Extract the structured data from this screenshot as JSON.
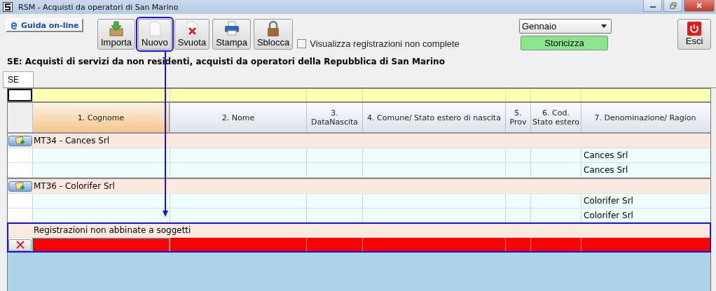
{
  "window": {
    "title": "RSM - Acquisti da operatori di San Marino"
  },
  "help_button": {
    "label": "Guida on-line"
  },
  "toolbar": [
    {
      "label": "Importa",
      "highlighted": false
    },
    {
      "label": "Nuovo",
      "highlighted": true
    },
    {
      "label": "Svuota",
      "highlighted": false
    },
    {
      "label": "Stampa",
      "highlighted": false
    },
    {
      "label": "Sblocca",
      "highlighted": false
    }
  ],
  "incomplete_checkbox": {
    "label": "Visualizza registrazioni non complete",
    "checked": false
  },
  "month_select": {
    "value": "Gennaio"
  },
  "archive_button": {
    "label": "Storicizza"
  },
  "exit_button": {
    "label": "Esci"
  },
  "heading": "SE: Acquisti di servizi da non residenti, acquisti da operatori della Repubblica di San Marino",
  "tabs": [
    {
      "label": "SE",
      "selected": true
    }
  ],
  "table": {
    "columns": [
      {
        "label": "1. Cognome",
        "selected": true
      },
      {
        "label": "2. Nome",
        "selected": false
      },
      {
        "label": "3. DataNascita",
        "selected": false
      },
      {
        "label": "4. Comune/ Stato estero di nascita",
        "selected": false
      },
      {
        "label": "5. Prov",
        "selected": false
      },
      {
        "label": "6. Cod. Stato estero",
        "selected": false
      },
      {
        "label": "7. Denominazione/ Ragion",
        "selected": false
      }
    ],
    "groups": [
      {
        "title": "MT34 - Cances Srl",
        "rows": [
          {
            "denominazione": "Cances Srl"
          },
          {
            "denominazione": "Cances Srl"
          }
        ]
      },
      {
        "title": "MT36 - Colorifer Srl",
        "rows": [
          {
            "denominazione": "Colorifer Srl"
          },
          {
            "denominazione": "Colorifer Srl"
          }
        ]
      }
    ],
    "unmatched": {
      "title": "Registrazioni non abbinate a soggetti",
      "highlighted": true,
      "rows": [
        {
          "error": true,
          "cells": [
            {
              "selected": true
            },
            {
              "selected": false
            },
            {
              "selected": false
            },
            {
              "selected": false
            },
            {
              "selected": false
            },
            {
              "selected": false
            },
            {
              "selected": false
            }
          ]
        }
      ]
    }
  }
}
